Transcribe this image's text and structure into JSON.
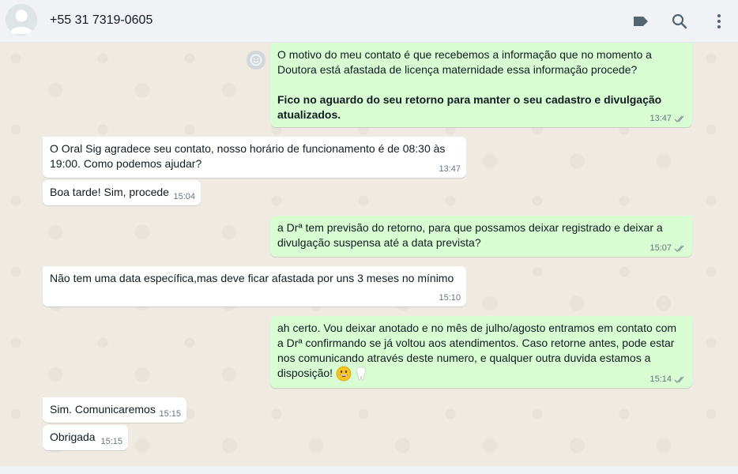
{
  "header": {
    "contact": "+55 31 7319-0605",
    "icons": [
      "label-icon",
      "search-icon",
      "menu-icon"
    ]
  },
  "messages": [
    {
      "dir": "out",
      "lines": [
        "O motivo do meu contato é que recebemos a informação que no momento a Doutora está afastada de licença maternidade essa informação procede?"
      ],
      "bold": "Fico no aguardo do seu retorno para manter o seu cadastro e divulgação atualizados.",
      "time": "13:47"
    },
    {
      "dir": "in",
      "text": "O Oral Sig agradece seu contato, nosso horário de funcionamento é de 08:30 às 19:00. Como podemos ajudar?",
      "time": "13:47"
    },
    {
      "dir": "in",
      "text": "Boa tarde! Sim, procede",
      "time": "15:04"
    },
    {
      "dir": "out",
      "text": "a Drª tem previsão do retorno, para que possamos deixar registrado e deixar a divulgação suspensa até a data prevista?",
      "time": "15:07"
    },
    {
      "dir": "in",
      "text": "Não tem uma data específica,mas deve ficar afastada por uns 3 meses no mínimo",
      "time": "15:10"
    },
    {
      "dir": "out",
      "text": "ah certo. Vou deixar anotado e no mês de julho/agosto entramos em contato com a Drª confirmando se já voltou aos atendimentos. Caso retorne antes, pode estar nos comunicando através deste numero, e qualquer outra duvida estamos a disposição!",
      "time": "15:14",
      "emojis": [
        "grinning-face-emoji",
        "tooth-emoji"
      ]
    },
    {
      "dir": "in",
      "text": "Sim. Comunicaremos",
      "time": "15:15"
    },
    {
      "dir": "in",
      "text": "Obrigada",
      "time": "15:15"
    }
  ],
  "colors": {
    "incoming": "#ffffff",
    "outgoing": "#d9fdd3",
    "background": "#efeae2",
    "read_tick": "#8696a0"
  }
}
